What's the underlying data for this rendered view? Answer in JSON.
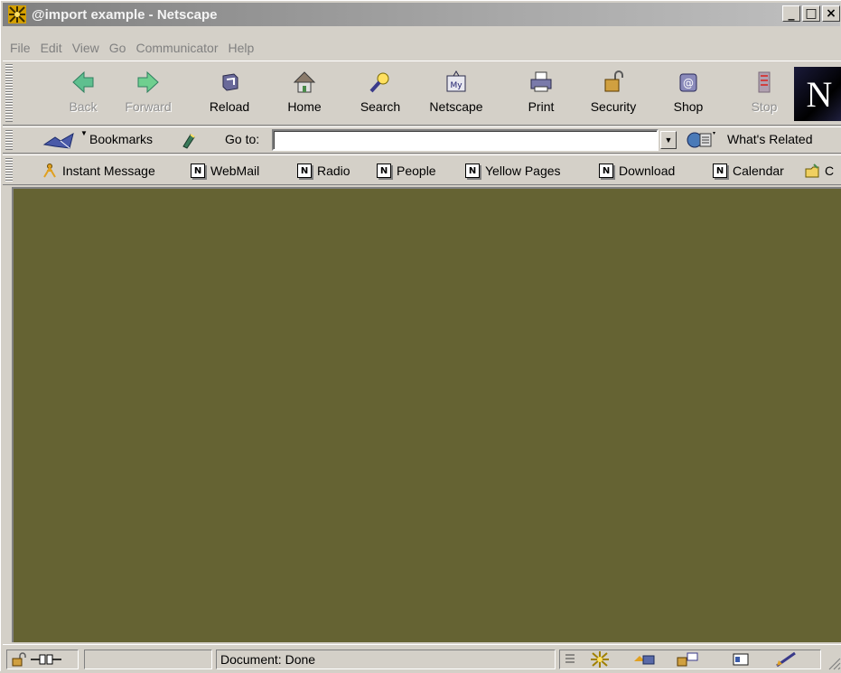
{
  "window": {
    "title": "@import example - Netscape",
    "controls": {
      "minimize": "_",
      "maximize": "□",
      "close": "×"
    }
  },
  "menu": [
    "File",
    "Edit",
    "View",
    "Go",
    "Communicator",
    "Help"
  ],
  "nav_toolbar": {
    "buttons": [
      {
        "label": "Back",
        "icon": "back-arrow-icon",
        "enabled": false
      },
      {
        "label": "Forward",
        "icon": "forward-arrow-icon",
        "enabled": false
      },
      {
        "label": "Reload",
        "icon": "reload-icon",
        "enabled": true
      },
      {
        "label": "Home",
        "icon": "home-icon",
        "enabled": true
      },
      {
        "label": "Search",
        "icon": "search-icon",
        "enabled": true
      },
      {
        "label": "Netscape",
        "icon": "my-netscape-icon",
        "enabled": true
      },
      {
        "label": "Print",
        "icon": "print-icon",
        "enabled": true
      },
      {
        "label": "Security",
        "icon": "security-lock-icon",
        "enabled": true
      },
      {
        "label": "Shop",
        "icon": "shop-icon",
        "enabled": true
      },
      {
        "label": "Stop",
        "icon": "stop-icon",
        "enabled": false
      }
    ],
    "logo": "N"
  },
  "location_toolbar": {
    "bookmarks_label": "Bookmarks",
    "goto_label": "Go to:",
    "url_value": "",
    "whats_related_label": "What's Related"
  },
  "personal_toolbar": {
    "items": [
      {
        "label": "Instant Message",
        "icon": "instant-message-icon"
      },
      {
        "label": "WebMail",
        "icon": "netscape-bookmark-icon"
      },
      {
        "label": "Radio",
        "icon": "netscape-bookmark-icon"
      },
      {
        "label": "People",
        "icon": "netscape-bookmark-icon"
      },
      {
        "label": "Yellow Pages",
        "icon": "netscape-bookmark-icon"
      },
      {
        "label": "Download",
        "icon": "netscape-bookmark-icon"
      },
      {
        "label": "Calendar",
        "icon": "netscape-bookmark-icon"
      },
      {
        "label": "C",
        "icon": "folder-icon"
      }
    ]
  },
  "content": {
    "background": "#656333"
  },
  "status_bar": {
    "status_text": "Document: Done"
  }
}
